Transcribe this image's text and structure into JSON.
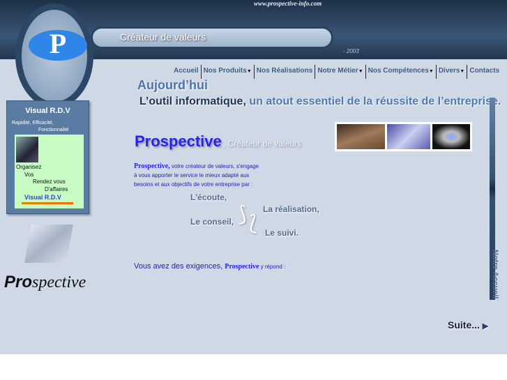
{
  "header": {
    "url": "www.prospective-info.com",
    "tagline": "Créateur de valeurs",
    "year": "- 2003",
    "logo_letter": "P"
  },
  "nav": [
    {
      "label": "Accueil",
      "dropdown": false
    },
    {
      "label": "Nos Produits",
      "dropdown": true
    },
    {
      "label": "Nos Réalisations",
      "dropdown": false
    },
    {
      "label": "Notre Métier",
      "dropdown": true
    },
    {
      "label": "Nos Compétences",
      "dropdown": true
    },
    {
      "label": "Divers",
      "dropdown": true
    },
    {
      "label": "Contacts",
      "dropdown": false
    }
  ],
  "main": {
    "today": "Aujourd’hui",
    "tool_a": "L’outil informatique, ",
    "tool_b": "un atout essentiel de la réussite de l’entreprise.",
    "brand_title": "Prospective",
    "brand_sub": ", Créateur de valeurs",
    "intro_brand": "Prospective,",
    "intro_1": " votre créateur de valeurs, s'engage",
    "intro_2": "à vous apporter le service le mieux adapté aux",
    "intro_3": "besoins et aux objectifs de votre entreprise par :",
    "steps": [
      "L'écoute,",
      "La réalisation,",
      "Le conseil,",
      "Le suivi."
    ],
    "exig_a": "Vous avez des exigences, ",
    "exig_brand": "Prospective",
    "exig_b": " y répond :",
    "suite": "Suite...",
    "side_tab": "Notre Accueil"
  },
  "widget": {
    "title": "Visual R.D.V",
    "sub1": "Rapidité, Efficacité,",
    "sub2": "Fonctionnalité",
    "lines": [
      "Organisez",
      "Vos",
      "Rendez vous",
      "D'affaires"
    ],
    "link": "Visual R.D.V"
  },
  "side_logo": {
    "bold": "Pro",
    "italic": "spective"
  },
  "colors": {
    "background": "#cfd9e6",
    "header": "#2a4160",
    "brand_blue": "#2424ee"
  }
}
